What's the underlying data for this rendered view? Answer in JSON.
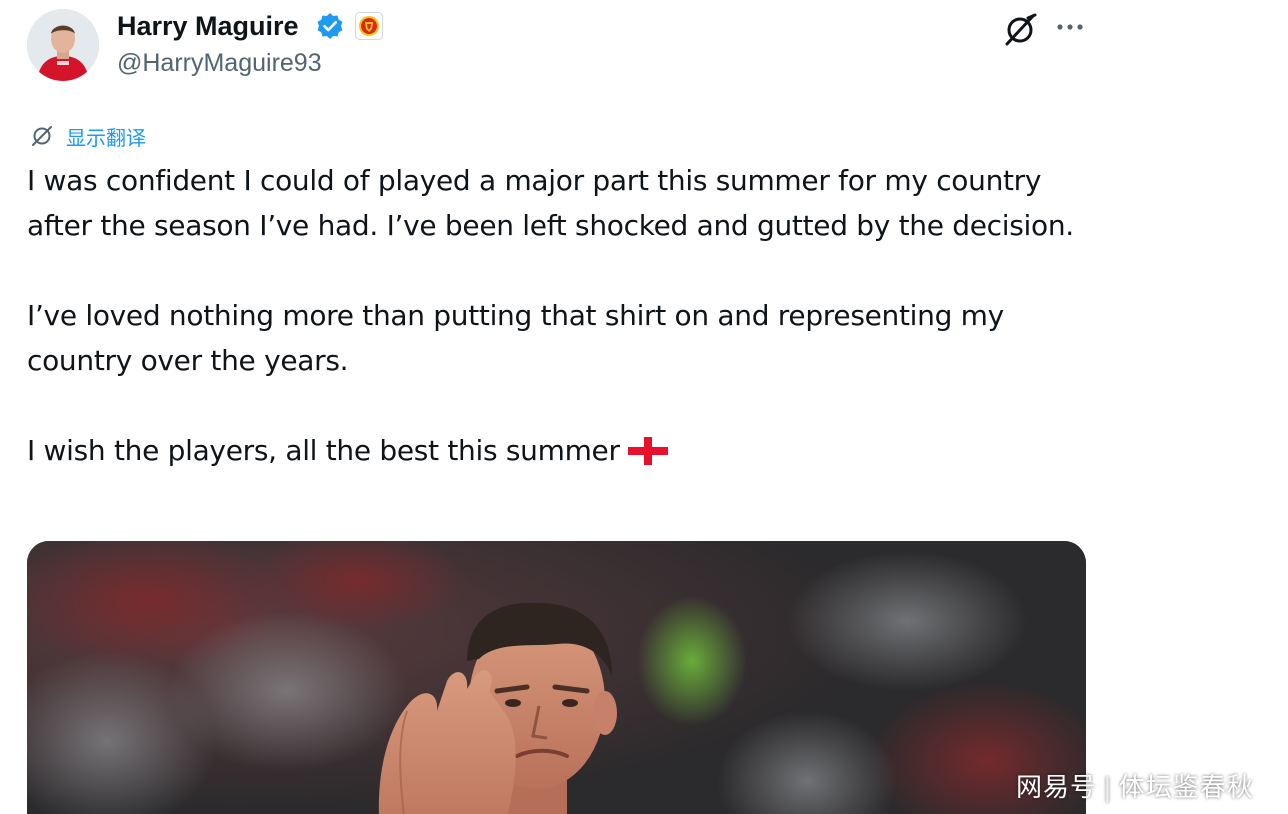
{
  "author": {
    "display_name": "Harry Maguire",
    "handle": "@HarryMaguire93",
    "avatar_icon": "player-avatar",
    "verified_icon": "verified-badge-icon",
    "affiliate_icon": "manchester-united-crest-icon"
  },
  "actions": {
    "grok_icon": "grok-icon",
    "more_icon": "more-icon"
  },
  "translate": {
    "label": "显示翻译"
  },
  "tweet": {
    "paragraphs": [
      "I was confident I could of played a major part this summer for my country after the season I’ve had. I’ve been left shocked and gutted by the decision.",
      "I’ve loved nothing more than putting that shirt on and representing my country over the years.",
      "I wish the players, all the best this summer"
    ],
    "emoji": "england-flag"
  },
  "media": {
    "description_icon": "player-applauding-photo"
  },
  "watermark": {
    "brand": "网易号",
    "account": "体坛鉴春秋"
  },
  "colors": {
    "text": "#0f1419",
    "secondary": "#536471",
    "accent": "#1d9bf0",
    "flag_red": "#e8112d"
  }
}
